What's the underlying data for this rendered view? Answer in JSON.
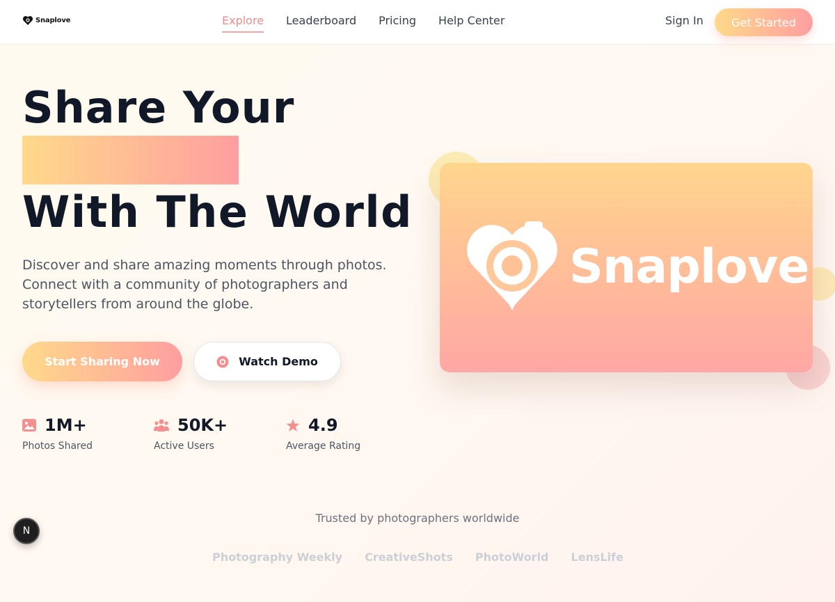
{
  "brand": {
    "name": "Snaplove"
  },
  "nav": {
    "links": [
      {
        "label": "Explore",
        "active": true
      },
      {
        "label": "Leaderboard",
        "active": false
      },
      {
        "label": "Pricing",
        "active": false
      },
      {
        "label": "Help Center",
        "active": false
      }
    ],
    "sign_in": "Sign In",
    "get_started": "Get Started"
  },
  "hero": {
    "title_line1": "Share Your",
    "title_line3": "With The World",
    "description": "Discover and share amazing moments through photos. Connect with a community of photographers and storytellers from around the globe.",
    "primary_cta": "Start Sharing Now",
    "secondary_cta": "Watch Demo"
  },
  "stats": [
    {
      "value": "1M+",
      "label": "Photos Shared",
      "icon": "image-icon"
    },
    {
      "value": "50K+",
      "label": "Active Users",
      "icon": "users-icon"
    },
    {
      "value": "4.9",
      "label": "Average Rating",
      "icon": "star-icon"
    }
  ],
  "card": {
    "wordmark": "Snaplove"
  },
  "trust": {
    "heading": "Trusted by photographers worldwide",
    "partners": [
      "Photography Weekly",
      "CreativeShots",
      "PhotoWorld",
      "LensLife"
    ]
  },
  "dev_badge": {
    "label": "N"
  },
  "colors": {
    "accent_gradient_start": "#ffd98a",
    "accent_gradient_end": "#ff9ea0",
    "active_link": "#f08c8c",
    "heading": "#111827"
  }
}
